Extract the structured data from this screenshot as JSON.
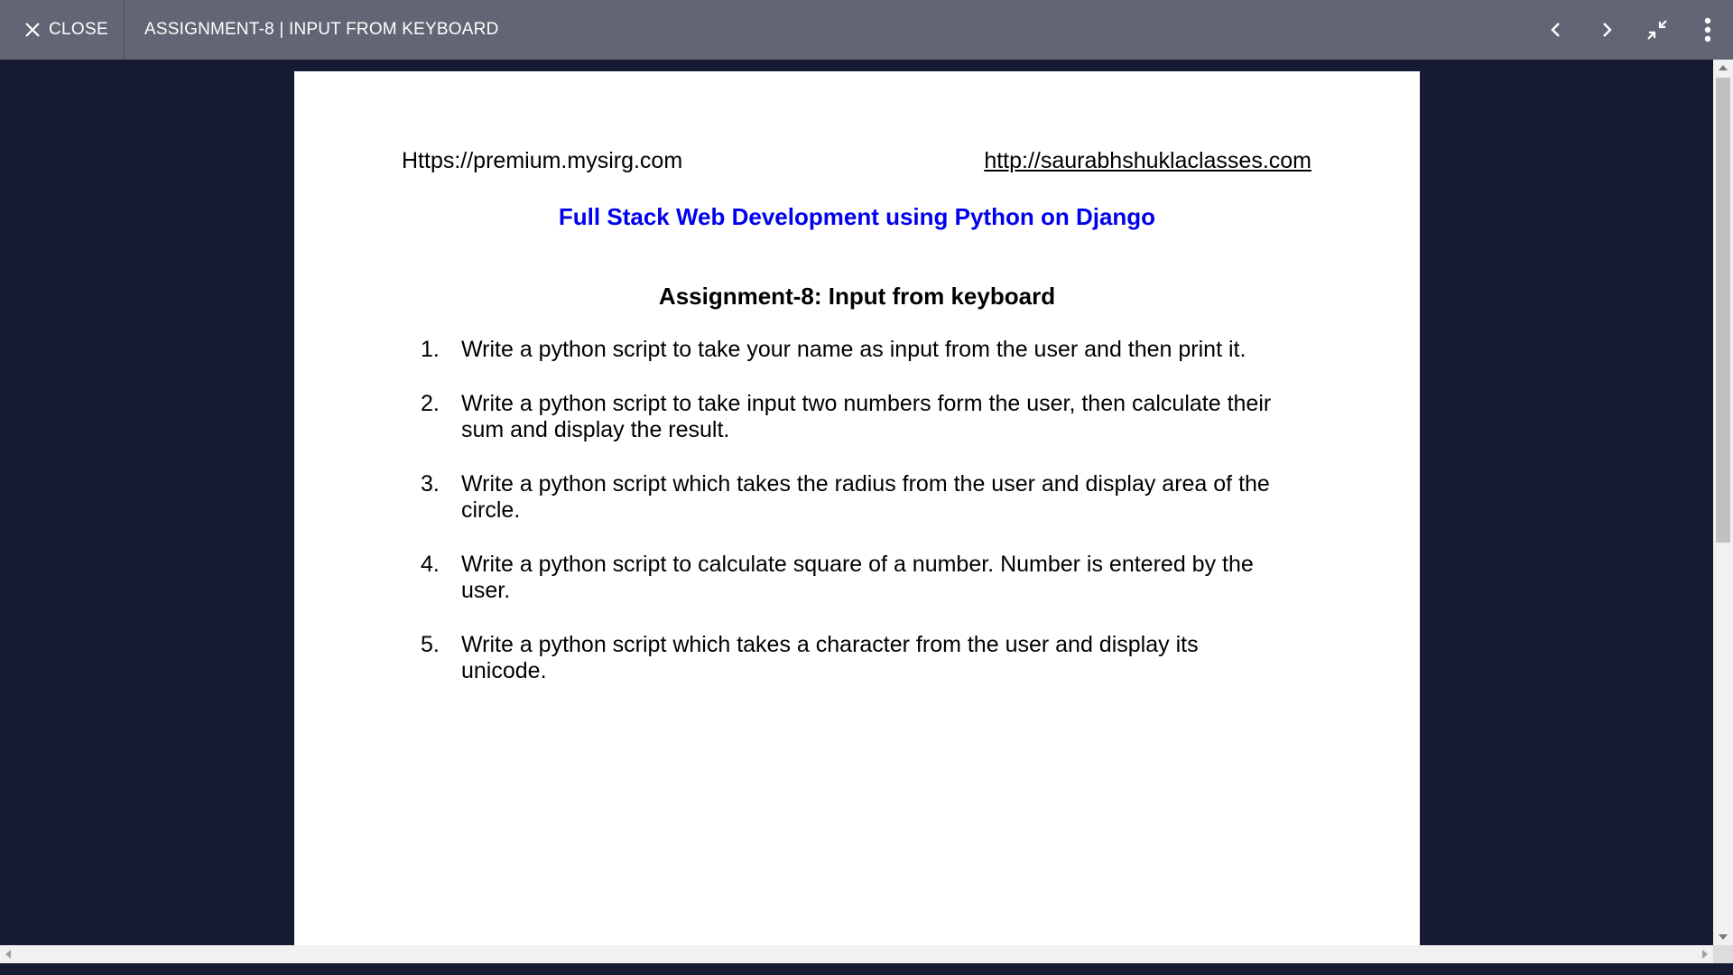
{
  "topbar": {
    "close_label": "CLOSE",
    "title": "ASSIGNMENT-8 | INPUT FROM KEYBOARD",
    "icons": [
      "close-icon",
      "chevron-left-icon",
      "chevron-right-icon",
      "exit-fullscreen-icon",
      "more-vertical-icon"
    ]
  },
  "document": {
    "url_left": "Https://premium.mysirg.com",
    "url_right": "http://saurabhshuklaclasses.com",
    "course_title": "Full Stack Web Development using Python on Django",
    "assignment_title": "Assignment-8: Input from keyboard",
    "tasks": [
      {
        "num": "1.",
        "text": "Write a python script to take your name as input from the user and then print it."
      },
      {
        "num": "2.",
        "text": "Write a python script to take input two numbers form the user, then calculate their sum and display the result."
      },
      {
        "num": "3.",
        "text": "Write a python script which takes the radius from the user and display area of the circle."
      },
      {
        "num": "4.",
        "text": "Write a python script to calculate square of a number. Number is entered by the user."
      },
      {
        "num": "5.",
        "text": "Write a python script which takes a character from the user and display its unicode."
      }
    ]
  },
  "colors": {
    "topbar_bg": "#626574",
    "viewer_bg": "#161b33",
    "course_title": "#0000ee"
  }
}
